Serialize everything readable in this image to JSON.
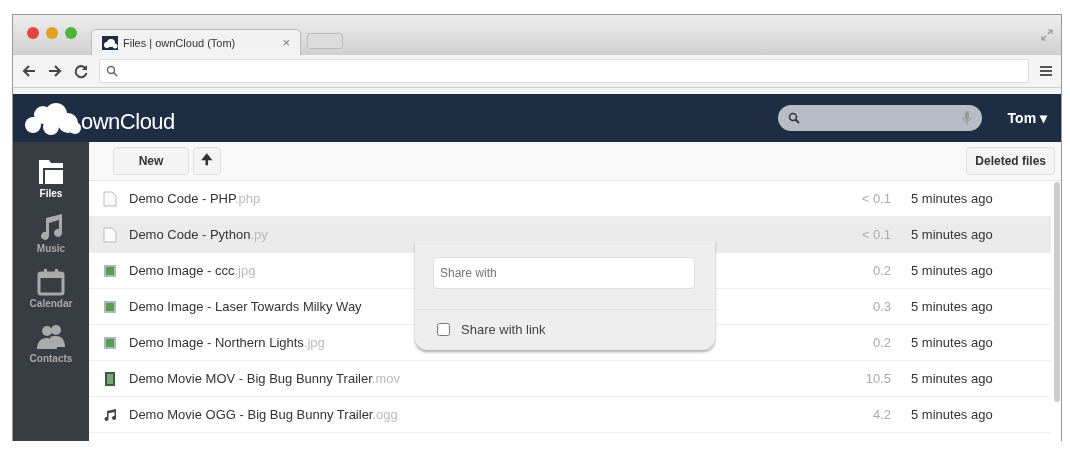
{
  "browser": {
    "tab_title": "Files | ownCloud (Tom)",
    "tab_close": "×"
  },
  "header": {
    "logo_text": "ownCloud",
    "user": "Tom ▾"
  },
  "sidebar": {
    "items": [
      {
        "label": "Files",
        "kind": "folder",
        "selected": true
      },
      {
        "label": "Music",
        "kind": "music",
        "selected": false
      },
      {
        "label": "Calendar",
        "kind": "calendar",
        "selected": false
      },
      {
        "label": "Contacts",
        "kind": "contacts",
        "selected": false
      }
    ]
  },
  "toolbar": {
    "new_button": "New",
    "upload_button": "🠉",
    "deleted_button": "Deleted files"
  },
  "files": [
    {
      "name": "Demo Code - PHP",
      "ext": ".php",
      "kind": "text",
      "size": "< 0.1",
      "modified": "5 minutes ago",
      "selected": false
    },
    {
      "name": "Demo Code - Python",
      "ext": ".py",
      "kind": "text",
      "size": "< 0.1",
      "modified": "5 minutes ago",
      "selected": true
    },
    {
      "name": "Demo Image - ccc",
      "ext": ".jpg",
      "kind": "image",
      "size": "0.2",
      "modified": "5 minutes ago",
      "selected": false
    },
    {
      "name": "Demo Image - Laser Towards Milky Way",
      "kind": "image",
      "size": "0.3",
      "modified": "5 minutes ago",
      "selected": false
    },
    {
      "name": "Demo Image - Northern Lights",
      "ext": ".jpg",
      "kind": "image",
      "size": "0.2",
      "modified": "5 minutes ago",
      "selected": false
    },
    {
      "name": "Demo Movie MOV - Big Bug Bunny Trailer",
      "ext": ".mov",
      "kind": "movie",
      "size": "10.5",
      "modified": "5 minutes ago",
      "selected": false
    },
    {
      "name": "Demo Movie OGG - Big Bug Bunny Trailer",
      "ext": ".ogg",
      "kind": "audio",
      "size": "4.2",
      "modified": "5 minutes ago",
      "selected": false
    }
  ],
  "share_popup": {
    "placeholder": "Share with",
    "link_label": "Share with link",
    "link_checked": false
  }
}
